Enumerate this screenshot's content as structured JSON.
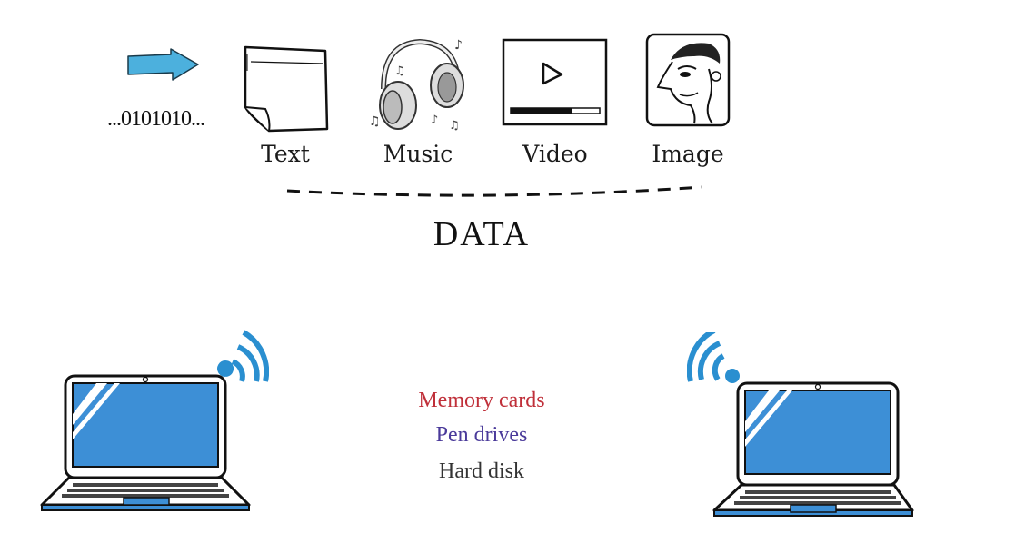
{
  "source": {
    "binary_text": "...0101010..."
  },
  "data_types": [
    {
      "label": "Text",
      "icon": "note-page-icon"
    },
    {
      "label": "Music",
      "icon": "headphones-icon"
    },
    {
      "label": "Video",
      "icon": "video-player-icon"
    },
    {
      "label": "Image",
      "icon": "caricature-portrait-icon"
    }
  ],
  "group_label": "DATA",
  "storage_media": [
    {
      "label": "Memory cards",
      "color": "#c0303a"
    },
    {
      "label": "Pen drives",
      "color": "#4a3a9a"
    },
    {
      "label": "Hard disk",
      "color": "#333333"
    }
  ],
  "colors": {
    "arrow": "#4cb0dd",
    "screen": "#3d8fd6",
    "wifi": "#2a8fd0"
  }
}
